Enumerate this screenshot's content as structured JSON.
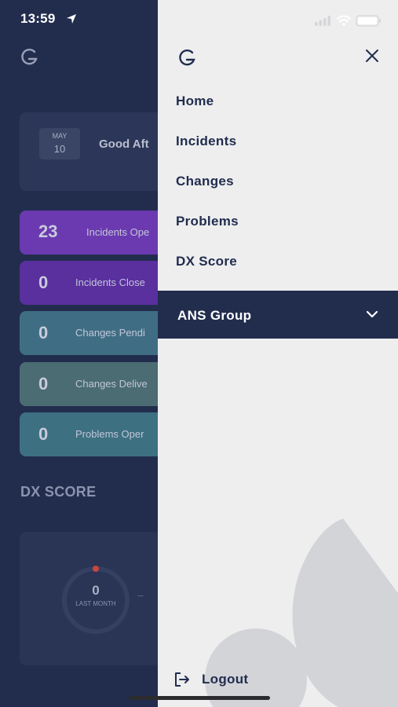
{
  "status_bar": {
    "time": "13:59"
  },
  "background": {
    "date": {
      "month": "MAY",
      "day": "10"
    },
    "greeting": "Good Aft",
    "stats": [
      {
        "count": "23",
        "label": "Incidents Ope",
        "color": "#6b3ab0"
      },
      {
        "count": "0",
        "label": "Incidents Close",
        "color": "#5a2f9e"
      },
      {
        "count": "0",
        "label": "Changes Pendi",
        "color": "#3f6e84"
      },
      {
        "count": "0",
        "label": "Changes Delive",
        "color": "#4a6c72"
      },
      {
        "count": "0",
        "label": "Problems Oper",
        "color": "#3d7081"
      }
    ],
    "dx_heading": "DX SCORE",
    "dx_value": "0",
    "dx_caption": "LAST MONTH"
  },
  "drawer": {
    "nav": [
      "Home",
      "Incidents",
      "Changes",
      "Problems",
      "DX Score"
    ],
    "group": "ANS Group",
    "logout": "Logout",
    "icons": {
      "logo": "brand-g-logo-icon",
      "close": "close-icon",
      "chevron": "chevron-down-icon",
      "logout": "logout-icon"
    }
  },
  "colors": {
    "navy": "#222d4e",
    "drawer_bg": "#eeeeef",
    "accent_red": "#c9453e"
  }
}
